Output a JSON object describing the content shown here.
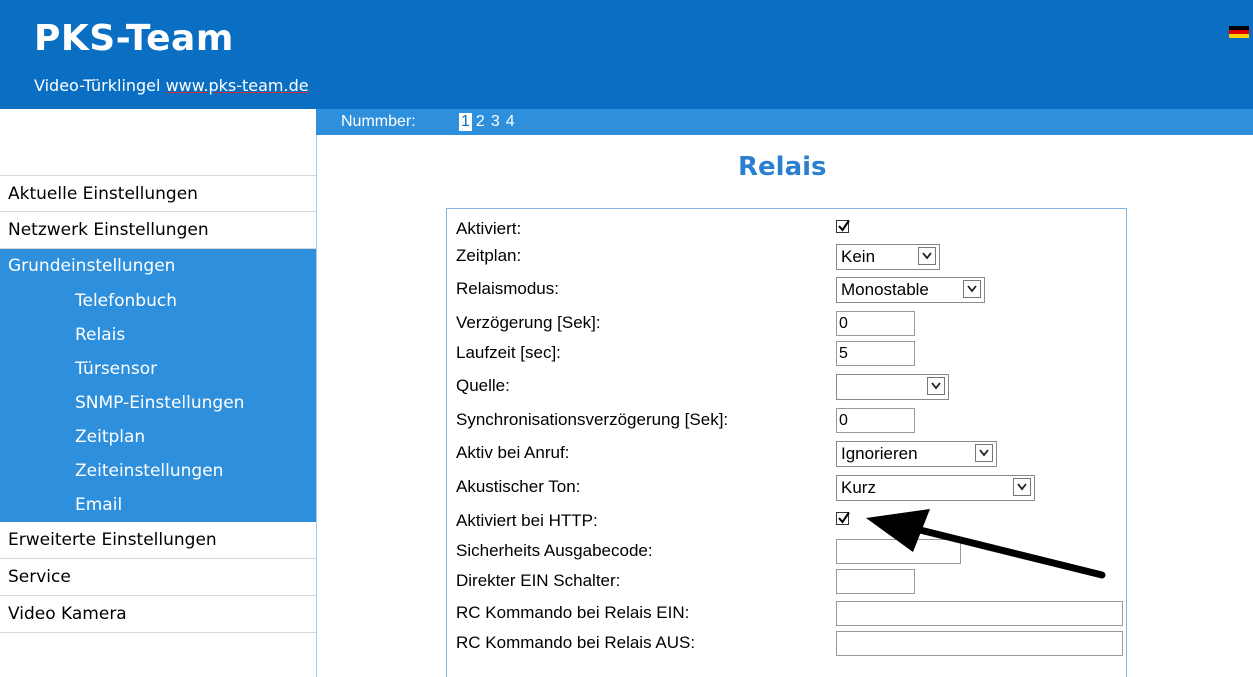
{
  "header": {
    "title": "PKS-Team",
    "subtitle_prefix": "Video-Türklingel ",
    "subtitle_url": "www.pks-team.de",
    "flag": "de-flag-icon"
  },
  "numbar": {
    "label": "Nummber:",
    "numbers": [
      "1",
      "2",
      "3",
      "4"
    ],
    "active": "1"
  },
  "sidebar": {
    "items_top": [
      "Aktuelle Einstellungen",
      "Netzwerk Einstellungen"
    ],
    "group_label": "Grundeinstellungen",
    "group_items": [
      "Telefonbuch",
      "Relais",
      "Türsensor",
      "SNMP-Einstellungen",
      "Zeitplan",
      "Zeiteinstellungen",
      "Email"
    ],
    "items_bottom": [
      "Erweiterte Einstellungen",
      "Service",
      "Video Kamera"
    ]
  },
  "page": {
    "title": "Relais"
  },
  "form": {
    "rows": [
      {
        "label": "Aktiviert:",
        "type": "checkbox",
        "checked": true
      },
      {
        "label": "Zeitplan:",
        "type": "select",
        "value": "Kein"
      },
      {
        "label": "Relaismodus:",
        "type": "select",
        "value": "Monostable"
      },
      {
        "label": "Verzögerung [Sek]:",
        "type": "text",
        "value": "0"
      },
      {
        "label": "Laufzeit [sec]:",
        "type": "text",
        "value": "5"
      },
      {
        "label": "Quelle:",
        "type": "select",
        "value": ""
      },
      {
        "label": "Synchronisationsverzögerung [Sek]:",
        "type": "text",
        "value": "0"
      },
      {
        "label": "Aktiv bei Anruf:",
        "type": "select",
        "value": "Ignorieren"
      },
      {
        "label": "Akustischer Ton:",
        "type": "select",
        "value": "Kurz"
      },
      {
        "label": "Aktiviert bei HTTP:",
        "type": "checkbox",
        "checked": true
      },
      {
        "label": "Sicherheits Ausgabecode:",
        "type": "text",
        "value": ""
      },
      {
        "label": "Direkter EIN Schalter:",
        "type": "text",
        "value": ""
      },
      {
        "label": "RC Kommando bei Relais EIN:",
        "type": "text",
        "value": ""
      },
      {
        "label": "RC Kommando bei Relais AUS:",
        "type": "text",
        "value": ""
      }
    ]
  },
  "colors": {
    "header_bg": "#0a6fc2",
    "accent": "#2e8fdd",
    "title": "#2a7fd0"
  }
}
